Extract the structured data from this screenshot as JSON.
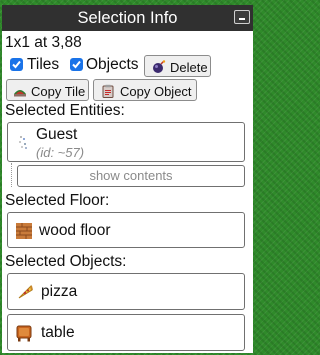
{
  "window": {
    "title": "Selection Info"
  },
  "selection": {
    "size_pos": "1x1 at 3,88"
  },
  "filters": {
    "tiles_label": "Tiles",
    "tiles_checked": true,
    "objects_label": "Objects",
    "objects_checked": true
  },
  "buttons": {
    "delete": "Delete",
    "copy_tile": "Copy Tile",
    "copy_object": "Copy Object"
  },
  "sections": {
    "entities": "Selected Entities:",
    "floor": "Selected Floor:",
    "objects": "Selected Objects:"
  },
  "entities": [
    {
      "name": "Guest",
      "id_text": "(id: ~57)",
      "icon": "guest-sprite-icon"
    }
  ],
  "show_contents": "show contents",
  "floor": {
    "name": "wood floor",
    "icon": "wood-floor-icon"
  },
  "objects": [
    {
      "name": "pizza",
      "icon": "pizza-icon"
    },
    {
      "name": "table",
      "icon": "table-icon"
    }
  ],
  "colors": {
    "accent": "#1a73e8",
    "titlebar": "#303030",
    "background": "#2f8a2a"
  }
}
